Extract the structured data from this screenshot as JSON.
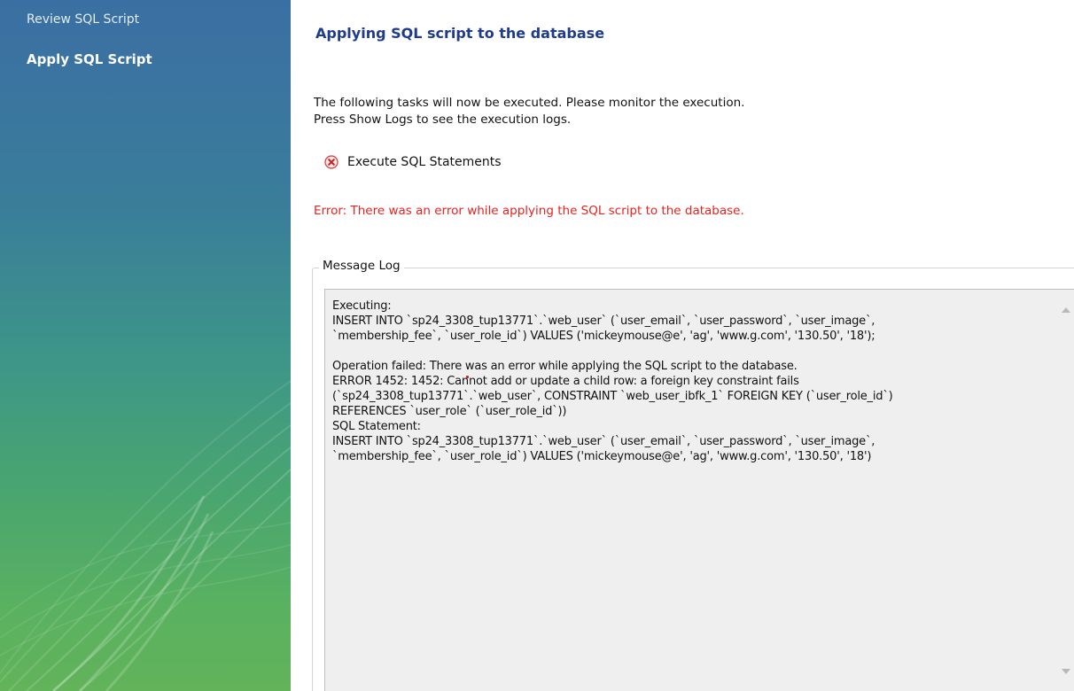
{
  "sidebar": {
    "items": [
      {
        "label": "Review SQL Script",
        "state": "done"
      },
      {
        "label": "Apply SQL Script",
        "state": "current"
      }
    ]
  },
  "main": {
    "title": "Applying SQL script to the database",
    "intro_line1": "The following tasks will now be executed. Please monitor the execution.",
    "intro_line2": "Press Show Logs to see the execution logs.",
    "task": {
      "icon": "error-x-icon",
      "label": "Execute SQL Statements"
    },
    "error_message": "Error: There was an error while applying the SQL script to the database.",
    "message_log": {
      "label": "Message Log",
      "text": "Executing:\nINSERT INTO `sp24_3308_tup13771`.`web_user` (`user_email`, `user_password`, `user_image`,\n`membership_fee`, `user_role_id`) VALUES ('mickeymouse@e', 'ag', 'www.g.com', '130.50', '18');\n\nOperation failed: There was an error while applying the SQL script to the database.\nERROR 1452: 1452: Cannot add or update a child row: a foreign key constraint fails\n(`sp24_3308_tup13771`.`web_user`, CONSTRAINT `web_user_ibfk_1` FOREIGN KEY (`user_role_id`)\nREFERENCES `user_role` (`user_role_id`))\nSQL Statement:\nINSERT INTO `sp24_3308_tup13771`.`web_user` (`user_email`, `user_password`, `user_image`,\n`membership_fee`, `user_role_id`) VALUES ('mickeymouse@e', 'ag', 'www.g.com', '130.50', '18')"
    }
  },
  "colors": {
    "title": "#1f3b8c",
    "error": "#e8221e",
    "log_background": "#efefef"
  }
}
